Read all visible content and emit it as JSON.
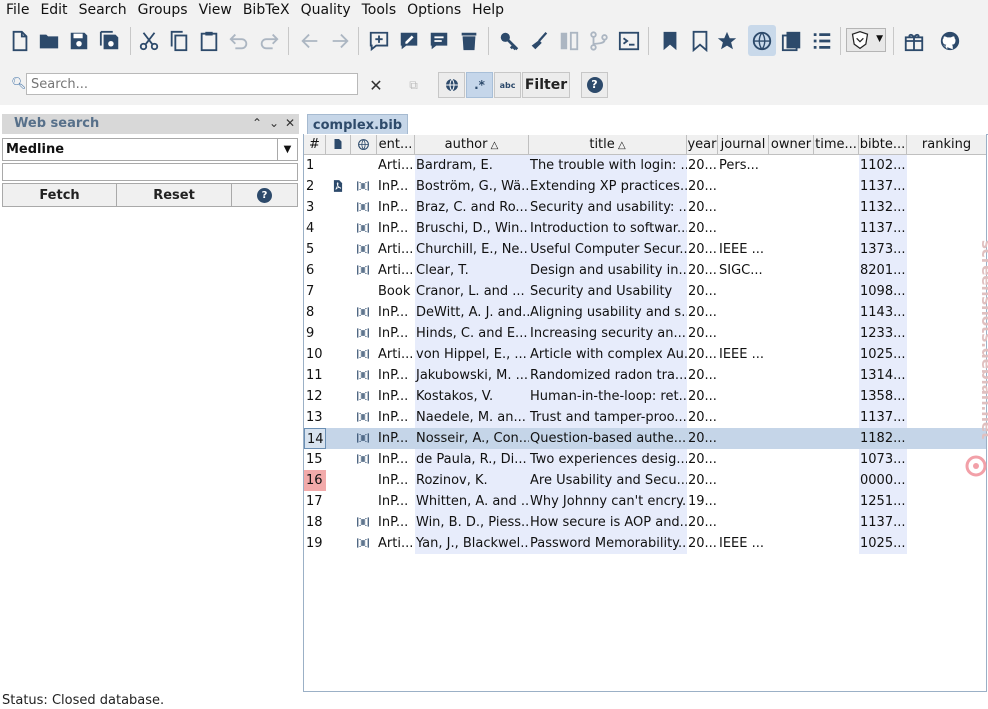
{
  "menu": [
    "File",
    "Edit",
    "Search",
    "Groups",
    "View",
    "BibTeX",
    "Quality",
    "Tools",
    "Options",
    "Help"
  ],
  "search": {
    "placeholder": "Search...",
    "filter_label": "Filter",
    "help_label": "?",
    "abc_label": "abc",
    "regex_label": ".*"
  },
  "web_search": {
    "title": "Web search",
    "fetcher": "Medline",
    "query": "",
    "fetch_label": "Fetch",
    "reset_label": "Reset",
    "help_label": "?"
  },
  "tab_label": "complex.bib",
  "table": {
    "columns": [
      "#",
      "",
      "",
      "ent...",
      "author",
      "title",
      "year",
      "journal",
      "owner",
      "time...",
      "bibte...",
      "ranking"
    ],
    "rows": [
      {
        "num": "1",
        "pdf": false,
        "link": false,
        "entry": "Arti...",
        "author": "Bardram, E.",
        "title": "The trouble with login: ...",
        "year": "20...",
        "journal": "Pers...",
        "bibtex": "1102..."
      },
      {
        "num": "2",
        "pdf": true,
        "link": true,
        "entry": "InP...",
        "author": "Boström, G., Wä...",
        "title": "Extending XP practices...",
        "year": "20...",
        "journal": "",
        "bibtex": "1137..."
      },
      {
        "num": "3",
        "pdf": false,
        "link": true,
        "entry": "InP...",
        "author": "Braz, C. and Ro...",
        "title": "Security and usability: ...",
        "year": "20...",
        "journal": "",
        "bibtex": "1132..."
      },
      {
        "num": "4",
        "pdf": false,
        "link": true,
        "entry": "InP...",
        "author": "Bruschi, D., Win...",
        "title": "Introduction to softwar...",
        "year": "20...",
        "journal": "",
        "bibtex": "1137..."
      },
      {
        "num": "5",
        "pdf": false,
        "link": true,
        "entry": "Arti...",
        "author": "Churchill, E., Ne...",
        "title": "Useful Computer Secur...",
        "year": "20...",
        "journal": "IEEE ...",
        "bibtex": "1373..."
      },
      {
        "num": "6",
        "pdf": false,
        "link": true,
        "entry": "Arti...",
        "author": "Clear, T.",
        "title": "Design and usability in...",
        "year": "20...",
        "journal": "SIGC...",
        "bibtex": "8201..."
      },
      {
        "num": "7",
        "pdf": false,
        "link": false,
        "entry": "Book",
        "author": "Cranor, L. and ...",
        "title": "Security and Usability",
        "year": "20...",
        "journal": "",
        "bibtex": "1098..."
      },
      {
        "num": "8",
        "pdf": false,
        "link": true,
        "entry": "InP...",
        "author": "DeWitt, A. J. and...",
        "title": "Aligning usability and s...",
        "year": "20...",
        "journal": "",
        "bibtex": "1143..."
      },
      {
        "num": "9",
        "pdf": false,
        "link": true,
        "entry": "InP...",
        "author": "Hinds, C. and E...",
        "title": "Increasing security an...",
        "year": "20...",
        "journal": "",
        "bibtex": "1233..."
      },
      {
        "num": "10",
        "pdf": false,
        "link": true,
        "entry": "Arti...",
        "author": "von Hippel, E., ...",
        "title": "Article with complex Au...",
        "year": "20...",
        "journal": "IEEE ...",
        "bibtex": "1025..."
      },
      {
        "num": "11",
        "pdf": false,
        "link": true,
        "entry": "InP...",
        "author": "Jakubowski, M. ...",
        "title": "Randomized radon tra...",
        "year": "20...",
        "journal": "",
        "bibtex": "1314..."
      },
      {
        "num": "12",
        "pdf": false,
        "link": true,
        "entry": "InP...",
        "author": "Kostakos, V.",
        "title": "Human-in-the-loop: ret...",
        "year": "20...",
        "journal": "",
        "bibtex": "1358..."
      },
      {
        "num": "13",
        "pdf": false,
        "link": true,
        "entry": "InP...",
        "author": "Naedele, M. an...",
        "title": "Trust and tamper-proo...",
        "year": "20...",
        "journal": "",
        "bibtex": "1137..."
      },
      {
        "num": "14",
        "pdf": false,
        "link": true,
        "entry": "InP...",
        "author": "Nosseir, A., Con...",
        "title": "Question-based authe...",
        "year": "20...",
        "journal": "",
        "bibtex": "1182...",
        "selected": true
      },
      {
        "num": "15",
        "pdf": false,
        "link": true,
        "entry": "InP...",
        "author": "de Paula, R., Di...",
        "title": "Two experiences desig...",
        "year": "20...",
        "journal": "",
        "bibtex": "1073..."
      },
      {
        "num": "16",
        "pdf": false,
        "link": false,
        "entry": "InP...",
        "author": "Rozinov, K.",
        "title": "Are Usability and Secu...",
        "year": "20...",
        "journal": "",
        "bibtex": "0000...",
        "warning": true
      },
      {
        "num": "17",
        "pdf": false,
        "link": false,
        "entry": "InP...",
        "author": "Whitten, A. and ...",
        "title": "Why Johnny can't encry...",
        "year": "19...",
        "journal": "",
        "bibtex": "1251..."
      },
      {
        "num": "18",
        "pdf": false,
        "link": true,
        "entry": "InP...",
        "author": "Win, B. D., Piess...",
        "title": "How secure is AOP and...",
        "year": "20...",
        "journal": "",
        "bibtex": "1137..."
      },
      {
        "num": "19",
        "pdf": false,
        "link": true,
        "entry": "Arti...",
        "author": "Yan, J., Blackwel...",
        "title": "Password Memorability...",
        "year": "20...",
        "journal": "IEEE ...",
        "bibtex": "1025..."
      }
    ]
  },
  "watermark": "screenshots.debian.net",
  "status": {
    "label": "Status:",
    "text": "Closed database."
  },
  "colors": {
    "accent": "#3b6ea5",
    "selected_row": "#c5d5e8",
    "sorted_column": "#e7ecfb",
    "warning": "#f2aaaa"
  }
}
